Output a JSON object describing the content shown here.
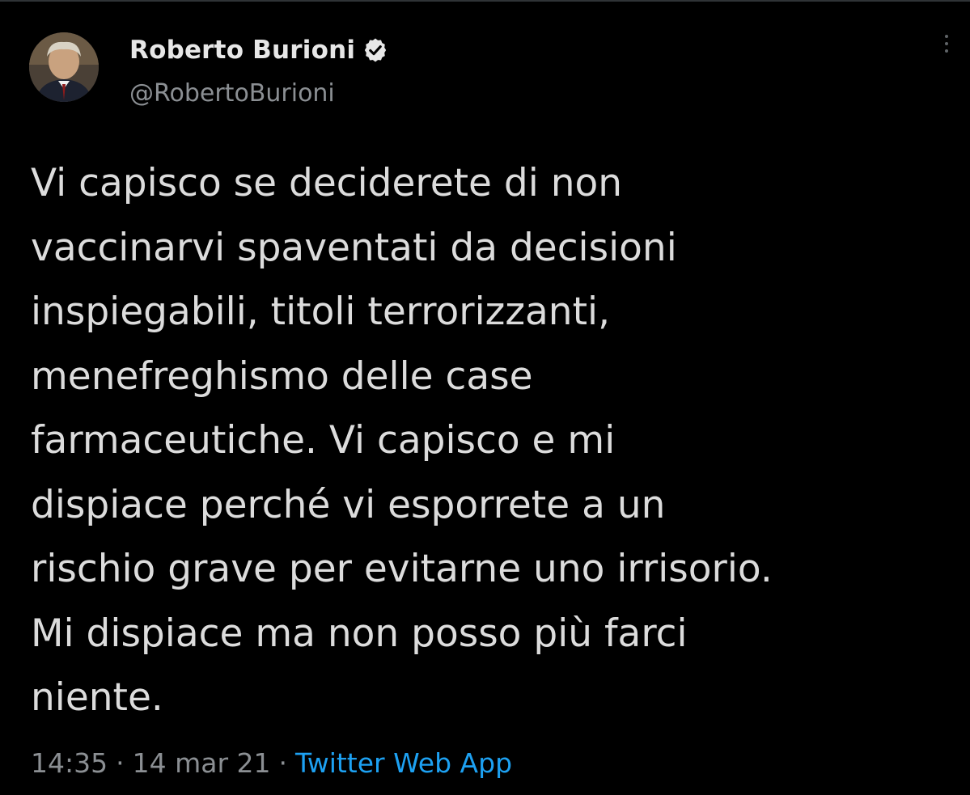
{
  "author": {
    "name": "Roberto Burioni",
    "handle": "@RobertoBurioni",
    "verified": true
  },
  "tweet": {
    "lines": [
      "Vi capisco se deciderete di non",
      "vaccinarvi spaventati da decisioni",
      "inspiegabili, titoli terrorizzanti,",
      "menefreghismo delle case",
      "farmaceutiche. Vi capisco e mi",
      "dispiace perché vi esporrete a un",
      "rischio grave per evitarne uno irrisorio.",
      "Mi dispiace ma non posso più farci",
      "niente."
    ],
    "time": "14:35",
    "date": "14 mar 21",
    "separator": "·",
    "source": "Twitter Web App"
  },
  "icons": {
    "verified": "verified-badge-icon",
    "more": "more-vertical-icon"
  },
  "colors": {
    "background": "#000000",
    "text": "#dcdcdc",
    "secondary": "#8b8f93",
    "link": "#1da1f2"
  }
}
